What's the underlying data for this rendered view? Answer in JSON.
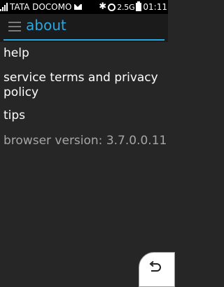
{
  "status": {
    "carrier": "TATA DOCOMO",
    "network": "2.5G",
    "time": "01:11"
  },
  "header": {
    "title": "about"
  },
  "menu": {
    "items": [
      {
        "label": "help"
      },
      {
        "label": "service terms and privacy policy"
      },
      {
        "label": "tips"
      }
    ],
    "version": "browser version: 3.7.0.0.11"
  },
  "colors": {
    "accent": "#29a8e0",
    "background": "#262626"
  },
  "icons": {
    "menu": "hamburger-icon",
    "back": "back-arrow-icon"
  }
}
